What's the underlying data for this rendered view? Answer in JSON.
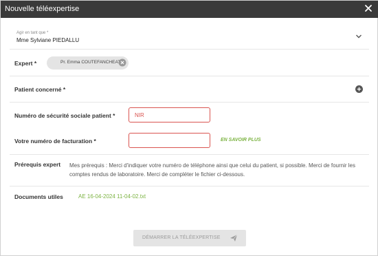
{
  "window": {
    "title": "Nouvelle téléexpertise"
  },
  "form": {
    "agir_label": "Agir en tant que *",
    "agir_value": "Mme Sylviane PIEDALLU",
    "expert_label": "Expert *",
    "expert_chip": "Pr. Emma COUTEFANCHEAT",
    "patient_label": "Patient concerné *",
    "nir_label": "Numéro de sécurité sociale patient *",
    "nir_placeholder": "NIR",
    "facturation_label": "Votre numéro de facturation *",
    "facturation_value": "",
    "en_savoir_plus": "EN SAVOIR PLUS",
    "prerequis_label": "Prérequis expert",
    "prerequis_text": "Mes prérequis : Merci d'indiquer votre numéro de téléphone ainsi que celui du patient, si possible. Merci de fournir les comptes rendus de laboratoire. Merci de compléter le fichier ci-dessous.",
    "documents_label": "Documents utiles",
    "document_link": "AE 16-04-2024 11-04-02.txt"
  },
  "actions": {
    "start_label": "DÉMARRER LA TÉLÉEXPERTISE"
  },
  "colors": {
    "titlebar": "#3a3a3a",
    "accent_green": "#7cb342",
    "error_red": "#d9534f",
    "disabled_bg": "#e4e4e4"
  },
  "icons": {
    "close": "close-icon",
    "chevron": "chevron-down-icon",
    "chip_remove": "remove-chip-icon",
    "add": "plus-circle-icon",
    "send": "send-icon"
  }
}
